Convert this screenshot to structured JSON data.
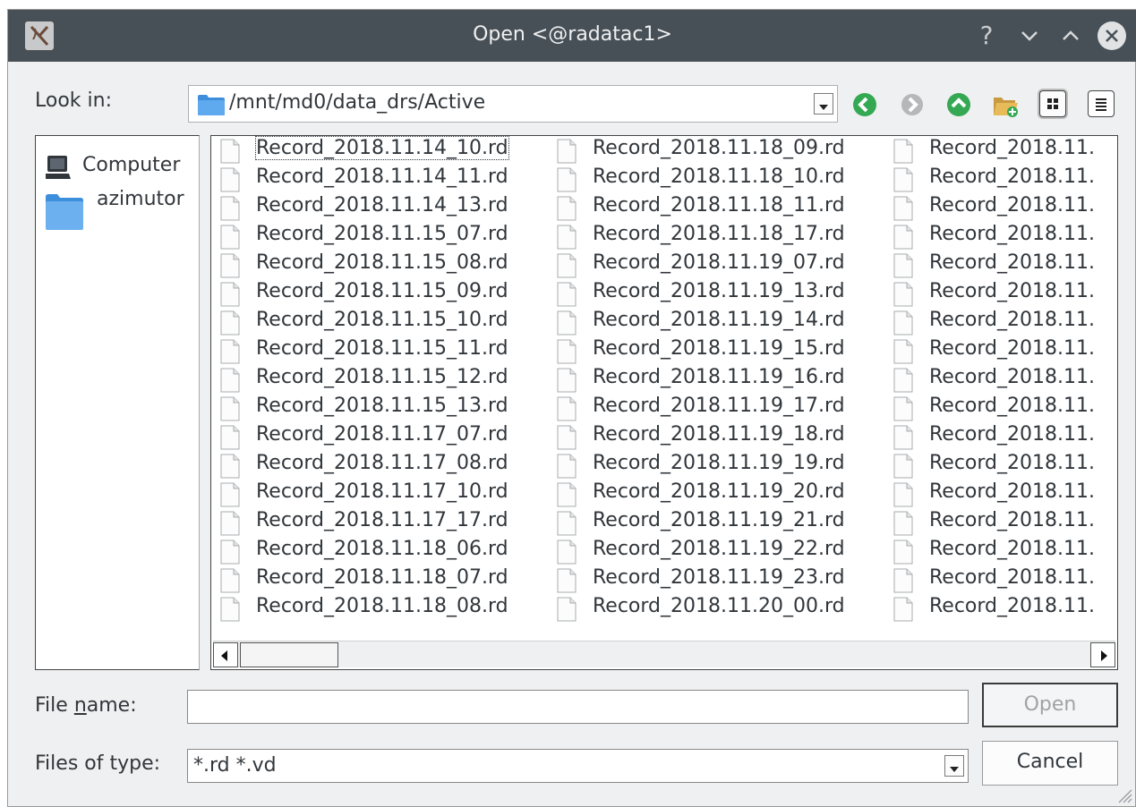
{
  "window": {
    "title": "Open <@radatac1>",
    "help_symbol": "?"
  },
  "lookin": {
    "label": "Look in:",
    "path": "/mnt/md0/data_drs/Active"
  },
  "toolbar": {
    "icons": [
      "back-icon",
      "forward-icon",
      "up-icon",
      "new-folder-icon",
      "icon-view-icon",
      "detail-view-icon"
    ]
  },
  "sidebar": {
    "items": [
      {
        "label": "Computer",
        "icon": "computer-icon"
      },
      {
        "label": "azimutor",
        "icon": "folder-icon"
      }
    ]
  },
  "files": {
    "columns": [
      [
        "Record_2018.11.14_10.rd",
        "Record_2018.11.14_11.rd",
        "Record_2018.11.14_13.rd",
        "Record_2018.11.15_07.rd",
        "Record_2018.11.15_08.rd",
        "Record_2018.11.15_09.rd",
        "Record_2018.11.15_10.rd",
        "Record_2018.11.15_11.rd",
        "Record_2018.11.15_12.rd",
        "Record_2018.11.15_13.rd",
        "Record_2018.11.17_07.rd",
        "Record_2018.11.17_08.rd",
        "Record_2018.11.17_10.rd",
        "Record_2018.11.17_17.rd",
        "Record_2018.11.18_06.rd",
        "Record_2018.11.18_07.rd",
        "Record_2018.11.18_08.rd"
      ],
      [
        "Record_2018.11.18_09.rd",
        "Record_2018.11.18_10.rd",
        "Record_2018.11.18_11.rd",
        "Record_2018.11.18_17.rd",
        "Record_2018.11.19_07.rd",
        "Record_2018.11.19_13.rd",
        "Record_2018.11.19_14.rd",
        "Record_2018.11.19_15.rd",
        "Record_2018.11.19_16.rd",
        "Record_2018.11.19_17.rd",
        "Record_2018.11.19_18.rd",
        "Record_2018.11.19_19.rd",
        "Record_2018.11.19_20.rd",
        "Record_2018.11.19_21.rd",
        "Record_2018.11.19_22.rd",
        "Record_2018.11.19_23.rd",
        "Record_2018.11.20_00.rd"
      ],
      [
        "Record_2018.11.",
        "Record_2018.11.",
        "Record_2018.11.",
        "Record_2018.11.",
        "Record_2018.11.",
        "Record_2018.11.",
        "Record_2018.11.",
        "Record_2018.11.",
        "Record_2018.11.",
        "Record_2018.11.",
        "Record_2018.11.",
        "Record_2018.11.",
        "Record_2018.11.",
        "Record_2018.11.",
        "Record_2018.11.",
        "Record_2018.11.",
        "Record_2018.11."
      ]
    ],
    "focused": "Record_2018.11.14_10.rd"
  },
  "filename": {
    "label": "File name:",
    "value": ""
  },
  "filetype": {
    "label": "Files of type:",
    "value": "*.rd *.vd"
  },
  "buttons": {
    "open": "Open",
    "cancel": "Cancel"
  },
  "colors": {
    "titlebar": "#475057",
    "window_bg": "#eff0f1",
    "nav_green": "#34a853",
    "folder_blue": "#3d8fdc"
  }
}
